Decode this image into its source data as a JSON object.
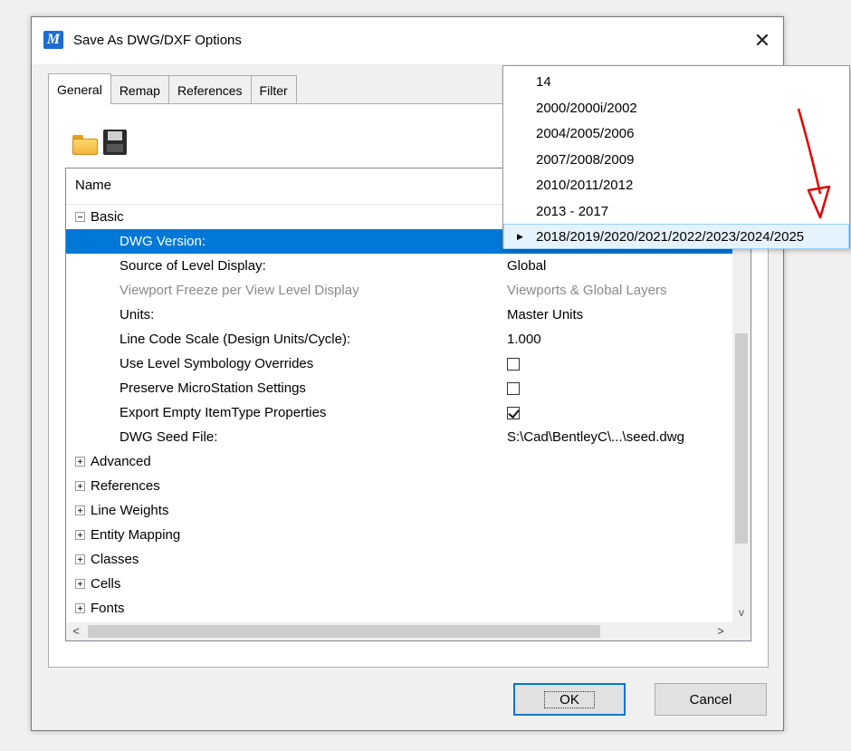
{
  "dialog": {
    "title": "Save As DWG/DXF Options",
    "close_glyph": "✕",
    "app_icon": "microstation-logo-icon",
    "app_icon_glyph": "M"
  },
  "tabs": [
    {
      "label": "General",
      "active": true
    },
    {
      "label": "Remap",
      "active": false
    },
    {
      "label": "References",
      "active": false
    },
    {
      "label": "Filter",
      "active": false
    }
  ],
  "toolbar": {
    "icons": [
      "folder-open-icon",
      "save-disk-icon"
    ]
  },
  "grid": {
    "column_header": "Name",
    "rows": [
      {
        "name": "Basic",
        "value": "",
        "kind": "group-expanded"
      },
      {
        "name": "DWG Version:",
        "value": "",
        "kind": "selected"
      },
      {
        "name": "Source of Level Display:",
        "value": "Global",
        "kind": "normal"
      },
      {
        "name": "Viewport Freeze per View Level Display",
        "value": "Viewports & Global Layers",
        "kind": "disabled"
      },
      {
        "name": "Units:",
        "value": "Master Units",
        "kind": "normal"
      },
      {
        "name": "Line Code Scale (Design Units/Cycle):",
        "value": "1.000",
        "kind": "normal"
      },
      {
        "name": "Use Level Symbology Overrides",
        "value": "",
        "kind": "checkbox",
        "checked": false
      },
      {
        "name": "Preserve MicroStation Settings",
        "value": "",
        "kind": "checkbox",
        "checked": false
      },
      {
        "name": "Export Empty ItemType Properties",
        "value": "",
        "kind": "checkbox",
        "checked": true
      },
      {
        "name": "DWG Seed File:",
        "value": "S:\\Cad\\BentleyC\\...\\seed.dwg",
        "kind": "normal"
      },
      {
        "name": "Advanced",
        "value": "",
        "kind": "group-collapsed"
      },
      {
        "name": "References",
        "value": "",
        "kind": "group-collapsed"
      },
      {
        "name": "Line Weights",
        "value": "",
        "kind": "group-collapsed"
      },
      {
        "name": "Entity Mapping",
        "value": "",
        "kind": "group-collapsed"
      },
      {
        "name": "Classes",
        "value": "",
        "kind": "group-collapsed"
      },
      {
        "name": "Cells",
        "value": "",
        "kind": "group-collapsed"
      },
      {
        "name": "Fonts",
        "value": "",
        "kind": "group-collapsed"
      }
    ]
  },
  "scrollbars": {
    "left_arrow": "<",
    "right_arrow": ">",
    "down_arrow": "v"
  },
  "buttons": {
    "ok": "OK",
    "cancel": "Cancel"
  },
  "dropdown": {
    "items": [
      {
        "label": "14",
        "selected": false
      },
      {
        "label": "2000/2000i/2002",
        "selected": false
      },
      {
        "label": "2004/2005/2006",
        "selected": false
      },
      {
        "label": "2007/2008/2009",
        "selected": false
      },
      {
        "label": "2010/2011/2012",
        "selected": false
      },
      {
        "label": "2013 - 2017",
        "selected": false
      },
      {
        "label": "2018/2019/2020/2021/2022/2023/2024/2025",
        "selected": true
      }
    ],
    "selected_marker_glyph": "▶"
  },
  "colors": {
    "selection": "#0078d7",
    "annotation_arrow": "#e00000",
    "dropdown_highlight": "#e5f3ff"
  }
}
